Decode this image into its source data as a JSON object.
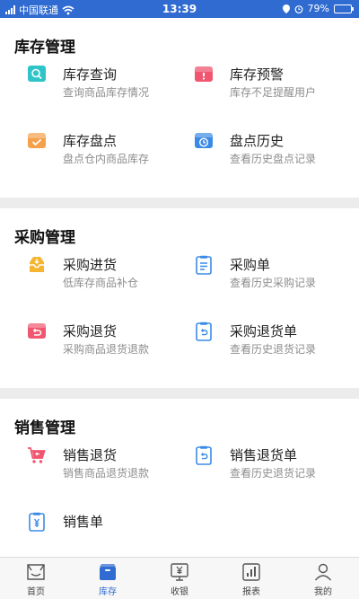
{
  "status_bar": {
    "carrier": "中国联通",
    "time": "13:39",
    "battery": "79%",
    "battery_level": 0.79
  },
  "sections": [
    {
      "title": "库存管理",
      "items": [
        {
          "title": "库存查询",
          "desc": "查询商品库存情况",
          "icon": "search-icon",
          "color": "#2ec4c8"
        },
        {
          "title": "库存预警",
          "desc": "库存不足提醒用户",
          "icon": "alert-box-icon",
          "color": "#f0566f"
        },
        {
          "title": "库存盘点",
          "desc": "盘点仓内商品库存",
          "icon": "check-box-icon",
          "color": "#f5a04a"
        },
        {
          "title": "盘点历史",
          "desc": "查看历史盘点记录",
          "icon": "history-icon",
          "color": "#3b8be6"
        }
      ]
    },
    {
      "title": "采购管理",
      "items": [
        {
          "title": "采购进货",
          "desc": "低库存商品补仓",
          "icon": "inbox-icon",
          "color": "#f5b530"
        },
        {
          "title": "采购单",
          "desc": "查看历史采购记录",
          "icon": "clipboard-icon",
          "color": "#3b8be6"
        },
        {
          "title": "采购退货",
          "desc": "采购商品退货退款",
          "icon": "return-icon",
          "color": "#f0566f"
        },
        {
          "title": "采购退货单",
          "desc": "查看历史退货记录",
          "icon": "return-clipboard-icon",
          "color": "#3b8be6"
        }
      ]
    },
    {
      "title": "销售管理",
      "items": [
        {
          "title": "销售退货",
          "desc": "销售商品退货退款",
          "icon": "cart-icon",
          "color": "#f0566f"
        },
        {
          "title": "销售退货单",
          "desc": "查看历史退货记录",
          "icon": "return-clipboard-icon",
          "color": "#3b8be6"
        },
        {
          "title": "销售单",
          "desc": "",
          "icon": "yen-clipboard-icon",
          "color": "#3b8be6"
        }
      ]
    }
  ],
  "tabbar": {
    "active": "库存",
    "tabs": [
      {
        "label": "首页",
        "icon": "home-icon"
      },
      {
        "label": "库存",
        "icon": "box-icon"
      },
      {
        "label": "收银",
        "icon": "cashier-icon"
      },
      {
        "label": "报表",
        "icon": "chart-icon"
      },
      {
        "label": "我的",
        "icon": "user-icon"
      }
    ]
  }
}
